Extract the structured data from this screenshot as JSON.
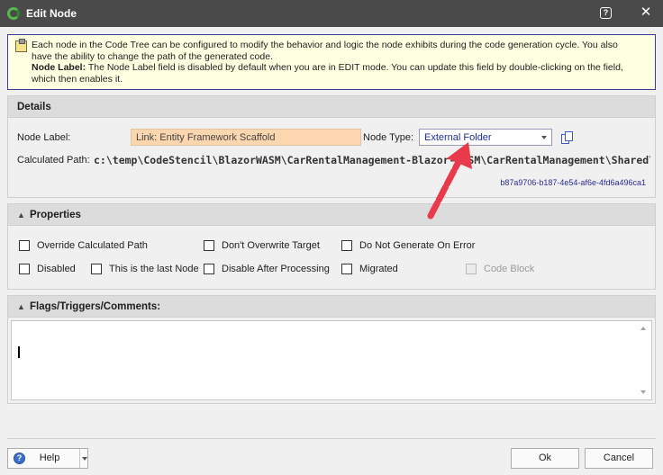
{
  "window": {
    "title": "Edit Node"
  },
  "info": {
    "line1": "Each node in the Code Tree can be configured to modify the behavior and logic the node exhibits during the code generation cycle. You also",
    "line2": "have the ability to change the path of the generated code.",
    "bold_label": "Node Label:",
    "line3_rest": " The Node Label field is disabled by default when you are in EDIT mode. You can update this field by double-clicking on the field,",
    "line4": "which then enables it."
  },
  "details": {
    "header": "Details",
    "node_label_label": "Node Label:",
    "node_label_value": "Link: Entity Framework Scaffold",
    "node_type_label": "Node Type:",
    "node_type_value": "External Folder",
    "calculated_path_label": "Calculated Path:",
    "calculated_path_value": "c:\\temp\\CodeStencil\\BlazorWASM\\CarRentalManagement-Blazor-WASM\\CarRentalManagement\\Shared\\Data",
    "guid": "b87a9706-b187-4e54-af6e-4fd6a496ca1"
  },
  "properties": {
    "header": "Properties",
    "override_calculated_path": "Override Calculated Path",
    "dont_overwrite_target": "Don't Overwrite Target",
    "do_not_generate_on_error": "Do Not Generate On Error",
    "disabled": "Disabled",
    "last_node": "This is the last Node",
    "disable_after_processing": "Disable After Processing",
    "migrated": "Migrated",
    "code_block": "Code Block"
  },
  "flags": {
    "header": "Flags/Triggers/Comments:"
  },
  "footer": {
    "help": "Help",
    "ok": "Ok",
    "cancel": "Cancel"
  },
  "colors": {
    "titlebar": "#4a4a4a",
    "annotation_arrow": "#e83a4a",
    "node_label_bg": "#fcd6ae"
  }
}
